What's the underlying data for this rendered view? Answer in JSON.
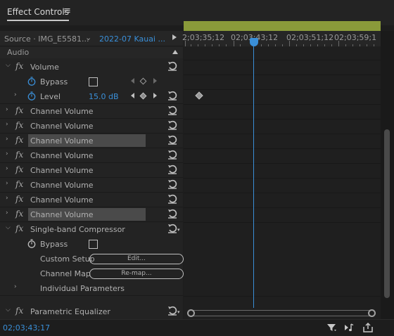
{
  "panel": {
    "title": "Effect Controls",
    "menu_glyph": "≡"
  },
  "source": {
    "source_label": "Source · IMG_E5581...",
    "dropdown_glyph": "⌄",
    "sequence_label": "2022-07 Kauai ..."
  },
  "section": {
    "audio_label": "Audio"
  },
  "effects": {
    "volume": {
      "name": "Volume",
      "bypass_label": "Bypass",
      "level_label": "Level",
      "level_value": "15.0 dB"
    },
    "channel_volume_name": "Channel Volume",
    "channel_volume_count": 8,
    "compressor": {
      "name": "Single-band Compressor",
      "bypass_label": "Bypass",
      "custom_setup_label": "Custom Setup",
      "edit_button_label": "Edit...",
      "channel_map_label": "Channel Map",
      "remap_button_label": "Re-map...",
      "individual_params_label": "Individual Parameters"
    },
    "equalizer": {
      "name": "Parametric Equalizer"
    }
  },
  "timeline": {
    "timecodes": [
      "2;03;35;12",
      "02;03;43;12",
      "02;03;51;12",
      "02;03;59;1"
    ],
    "current_timecode": "02;03;43;17",
    "playhead_position_fraction": 0.353
  },
  "colors": {
    "accent": "#3a8fd8",
    "work_area": "#8a9a3a",
    "highlight_row": "#4a4a4a"
  },
  "icons": [
    "hamburger-menu-icon",
    "fx-icon",
    "stopwatch-icon",
    "reset-icon",
    "filter-icon",
    "play-only-audio-icon",
    "export-icon"
  ]
}
